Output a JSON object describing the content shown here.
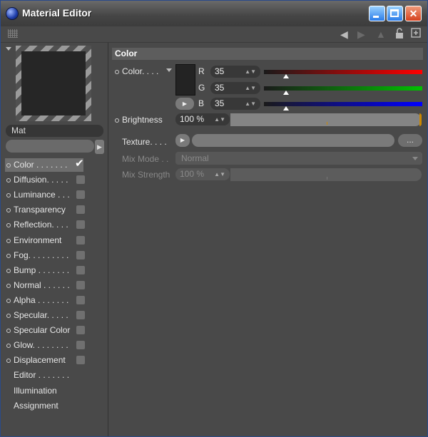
{
  "window": {
    "title": "Material Editor",
    "minimize": "",
    "maximize": "",
    "close": "✕"
  },
  "toolbar": {
    "back_icon": "back-arrow-icon",
    "forward_icon": "forward-arrow-icon",
    "up_icon": "up-arrow-icon",
    "lock_icon": "lock-icon",
    "new_icon": "new-panel-icon"
  },
  "material": {
    "name": "Mat"
  },
  "channels": [
    {
      "label": "Color . . . . . . .",
      "checked": true
    },
    {
      "label": "Diffusion. . . . .",
      "checked": false
    },
    {
      "label": "Luminance . . .",
      "checked": false
    },
    {
      "label": "Transparency",
      "checked": false
    },
    {
      "label": "Reflection. . . .",
      "checked": false
    },
    {
      "label": "Environment",
      "checked": false
    },
    {
      "label": "Fog. . . . . . . . .",
      "checked": false
    },
    {
      "label": "Bump . . . . . . .",
      "checked": false
    },
    {
      "label": "Normal . . . . . .",
      "checked": false
    },
    {
      "label": "Alpha . . . . . . .",
      "checked": false
    },
    {
      "label": "Specular. . . . .",
      "checked": false
    },
    {
      "label": "Specular Color",
      "checked": false
    },
    {
      "label": "Glow. . . . . . . .",
      "checked": false
    },
    {
      "label": "Displacement",
      "checked": false
    }
  ],
  "extra_items": [
    "Editor . . . . . . .",
    "Illumination",
    "Assignment"
  ],
  "panel": {
    "section_title": "Color",
    "color_label": "Color. . . .",
    "r_label": "R",
    "g_label": "G",
    "b_label": "B",
    "r_value": "35",
    "g_value": "35",
    "b_value": "35",
    "r_level": 0.14,
    "g_level": 0.14,
    "b_level": 0.14,
    "brightness_label": "Brightness",
    "brightness_value": "100 %",
    "texture_label": "Texture. . . .",
    "texture_dots": "...",
    "mixmode_label": "Mix Mode . .",
    "mixmode_value": "Normal",
    "mixstrength_label": "Mix Strength",
    "mixstrength_value": "100 %"
  },
  "colors": {
    "red": "#ff0000",
    "green": "#00c000",
    "blue": "#0000ff"
  }
}
